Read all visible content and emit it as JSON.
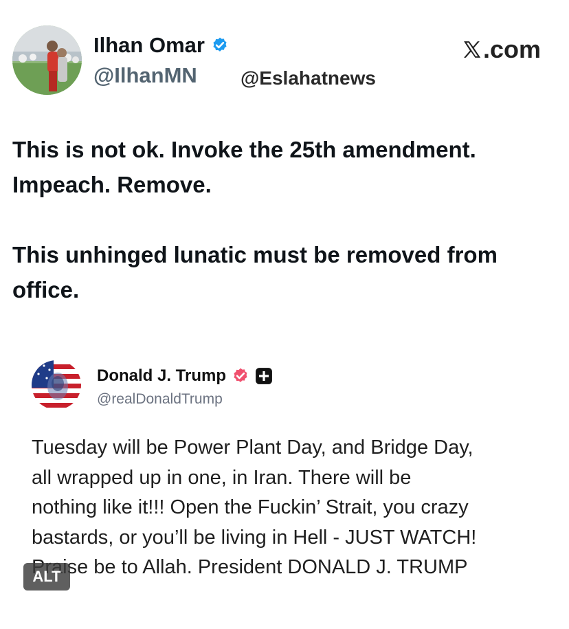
{
  "author": {
    "name": "Ilhan Omar",
    "handle": "@IlhanMN"
  },
  "watermark": "@Eslahatnews",
  "site_label": ".com",
  "post": {
    "paragraphs": [
      "This is not ok. Invoke the 25th amendment. Impeach. Remove.",
      "This unhinged lunatic must be removed from office."
    ]
  },
  "quoted": {
    "name": "Donald J. Trump",
    "handle": "@realDonaldTrump",
    "body": "Tuesday will be Power Plant Day, and Bridge Day,\nall wrapped up in one, in Iran. There will be\nnothing like it!!! Open the Fuckin’ Strait, you crazy\nbastards, or you’ll be living in Hell - JUST WATCH!\nPraise be to Allah. President DONALD J. TRUMP",
    "alt_badge": "ALT"
  },
  "icons": {
    "author_badge": "blue-verified-badge-icon",
    "quoted_badge": "pink-verified-badge-icon",
    "quoted_plus": "plus-square-icon",
    "site_logo": "x-logo-icon"
  },
  "colors": {
    "verified_blue": "#1d9bf0",
    "verified_pink": "#f0506e",
    "text_primary": "#0f1419",
    "text_secondary": "#536471"
  }
}
